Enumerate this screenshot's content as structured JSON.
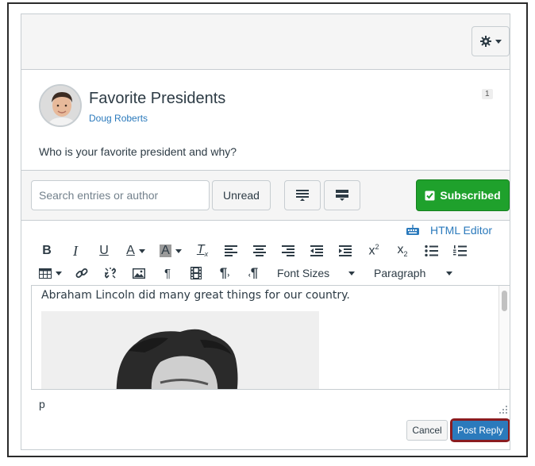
{
  "header": {
    "settings_icon": "gear-icon"
  },
  "post": {
    "title": "Favorite Presidents",
    "author": "Doug Roberts",
    "unread_count": "1",
    "body": "Who is your favorite president and why?"
  },
  "toolbar": {
    "search_placeholder": "Search entries or author",
    "unread_label": "Unread",
    "subscribed_label": "Subscribed",
    "colors": {
      "subscribed_bg": "#1fa12c",
      "link": "#2b7abc"
    }
  },
  "editor": {
    "html_editor_label": "HTML Editor",
    "font_sizes_label": "Font Sizes",
    "paragraph_label": "Paragraph",
    "content_text": "Abraham Lincoln did many great things for our country.",
    "status_path": "p",
    "icons": [
      "bold-icon",
      "italic-icon",
      "underline-icon",
      "text-color-icon",
      "background-color-icon",
      "clear-formatting-icon",
      "align-left-icon",
      "align-center-icon",
      "align-right-icon",
      "outdent-icon",
      "indent-icon",
      "superscript-icon",
      "subscript-icon",
      "bullet-list-icon",
      "numbered-list-icon",
      "table-icon",
      "link-icon",
      "unlink-icon",
      "image-icon",
      "pilcrow-icon",
      "media-icon",
      "ltr-icon",
      "rtl-icon"
    ]
  },
  "actions": {
    "cancel_label": "Cancel",
    "post_reply_label": "Post Reply",
    "highlight_color": "#8a1c20"
  }
}
